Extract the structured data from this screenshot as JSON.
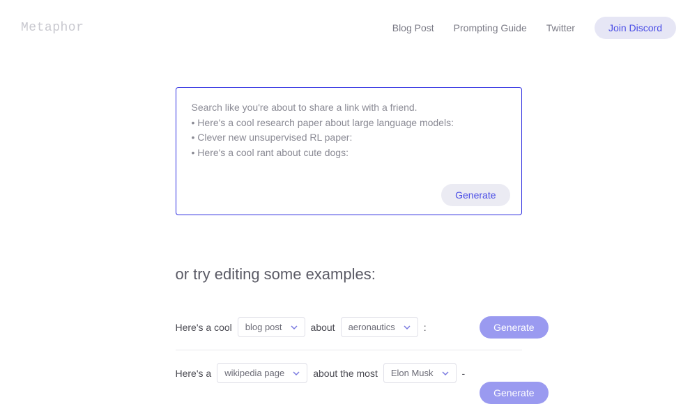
{
  "header": {
    "logo": "Metaphor",
    "nav": {
      "blog": "Blog Post",
      "guide": "Prompting Guide",
      "twitter": "Twitter",
      "discord": "Join Discord"
    }
  },
  "search": {
    "line1": "Search like you're about to share a link with a friend.",
    "bullet1": "• Here's a cool research paper about large language models:",
    "bullet2": "• Clever new unsupervised RL paper:",
    "bullet3": "• Here's a cool rant about cute dogs:",
    "generate": "Generate"
  },
  "examples": {
    "title": "or try editing some examples:",
    "row1": {
      "prefix": "Here's a cool",
      "dropdown1": "blog post",
      "middle": "about",
      "dropdown2": "aeronautics",
      "suffix": ":",
      "generate": "Generate"
    },
    "row2": {
      "prefix": "Here's a",
      "dropdown1": "wikipedia page",
      "middle": "about the most",
      "dropdown2": "Elon Musk",
      "suffix": "-",
      "generate": "Generate"
    }
  }
}
